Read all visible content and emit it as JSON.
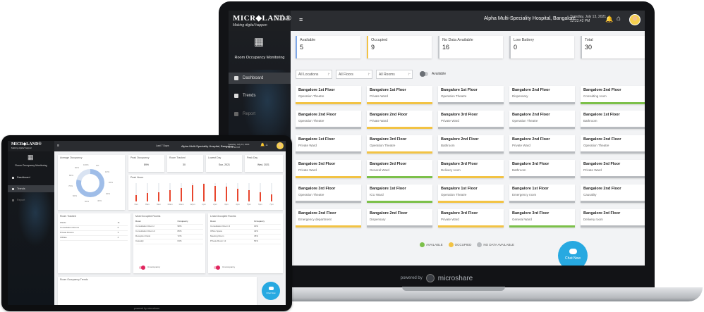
{
  "laptop": {
    "brand": {
      "logo": "MICR◆LAND®",
      "tagline": "Making digital happen",
      "established": "Ahead since 1989"
    },
    "header": {
      "hospital": "Alpha Multi-Speciality Hospital, Bangalore",
      "date": "Tuesday, July 13, 2021",
      "time": "12:22:42 PM"
    },
    "sidebar": {
      "app_name": "Room Occupancy Monitoring",
      "items": [
        {
          "label": "Dashboard"
        },
        {
          "label": "Trends"
        },
        {
          "label": "Report"
        }
      ]
    },
    "stats": [
      {
        "label": "Available",
        "value": "5",
        "color": "#7fa8e8"
      },
      {
        "label": "Occupied",
        "value": "9",
        "color": "#f2c344"
      },
      {
        "label": "No Data Available",
        "value": "16",
        "color": "#c3c6ca"
      },
      {
        "label": "Low Battery",
        "value": "0",
        "color": "#c3c6ca"
      },
      {
        "label": "Total",
        "value": "30",
        "color": "#c3c6ca"
      }
    ],
    "filters": {
      "location": "All Locations",
      "floor": "All Floors",
      "room": "All Rooms",
      "toggle_label": "Available"
    },
    "rooms": [
      [
        {
          "floor": "Bangalore 1st Floor",
          "room": "Operation Theatre",
          "status": "occupied"
        },
        {
          "floor": "Bangalore 1st Floor",
          "room": "Private Ward",
          "status": "occupied"
        },
        {
          "floor": "Bangalore 1st Floor",
          "room": "Operation Theatre",
          "status": "nodata"
        },
        {
          "floor": "Bangalore 2nd Floor",
          "room": "Dispensary",
          "status": "nodata"
        },
        {
          "floor": "Bangalore 2nd Floor",
          "room": "Consulting room",
          "status": "available"
        }
      ],
      [
        {
          "floor": "Bangalore 2nd Floor",
          "room": "Operation Theatre",
          "status": "nodata"
        },
        {
          "floor": "Bangalore 2nd Floor",
          "room": "Private Ward",
          "status": "occupied"
        },
        {
          "floor": "Bangalore 3rd Floor",
          "room": "Private Ward",
          "status": "nodata"
        },
        {
          "floor": "Bangalore 2nd Floor",
          "room": "Operation Theatre",
          "status": "nodata"
        },
        {
          "floor": "Bangalore 1st Floor",
          "room": "Bathroom",
          "status": "nodata"
        }
      ],
      [
        {
          "floor": "Bangalore 1st Floor",
          "room": "Private Ward",
          "status": "nodata"
        },
        {
          "floor": "Bangalore 3rd Floor",
          "room": "Operation Theatre",
          "status": "occupied"
        },
        {
          "floor": "Bangalore 2nd Floor",
          "room": "Bathroom",
          "status": "nodata"
        },
        {
          "floor": "Bangalore 2nd Floor",
          "room": "Private Ward",
          "status": "nodata"
        },
        {
          "floor": "Bangalore 2nd Floor",
          "room": "Operation Theatre",
          "status": "nodata"
        }
      ],
      [
        {
          "floor": "Bangalore 3rd Floor",
          "room": "Private Ward",
          "status": "occupied"
        },
        {
          "floor": "Bangalore 3rd Floor",
          "room": "General Ward",
          "status": "available"
        },
        {
          "floor": "Bangalore 3rd Floor",
          "room": "Delivery room",
          "status": "occupied"
        },
        {
          "floor": "Bangalore 3rd Floor",
          "room": "Bathroom",
          "status": "nodata"
        },
        {
          "floor": "Bangalore 3rd Floor",
          "room": "Private Ward",
          "status": "nodata"
        }
      ],
      [
        {
          "floor": "Bangalore 3rd Floor",
          "room": "Operation Theatre",
          "status": "nodata"
        },
        {
          "floor": "Bangalore 1st Floor",
          "room": "ICU Ward",
          "status": "available"
        },
        {
          "floor": "Bangalore 1st Floor",
          "room": "Operation Theatre",
          "status": "occupied"
        },
        {
          "floor": "Bangalore 1st Floor",
          "room": "Emergency room",
          "status": "nodata"
        },
        {
          "floor": "Bangalore 2nd Floor",
          "room": "Causality",
          "status": "nodata"
        }
      ],
      [
        {
          "floor": "Bangalore 2nd Floor",
          "room": "Emergency department",
          "status": "occupied"
        },
        {
          "floor": "Bangalore 2nd Floor",
          "room": "Dispensary",
          "status": "nodata"
        },
        {
          "floor": "Bangalore 3rd Floor",
          "room": "Private Ward",
          "status": "occupied"
        },
        {
          "floor": "Bangalore 3rd Floor",
          "room": "General Ward",
          "status": "available"
        },
        {
          "floor": "Bangalore 3rd Floor",
          "room": "Delivery room",
          "status": "nodata"
        }
      ]
    ],
    "legend": [
      {
        "label": "AVAILABLE",
        "color": "#7cc04a"
      },
      {
        "label": "OCCUPIED",
        "color": "#f2c344"
      },
      {
        "label": "NO DATA AVAILABLE",
        "color": "#b8bbbf"
      }
    ],
    "chat_label": "Chat Now",
    "footer": {
      "powered": "powered by",
      "brand": "microshare"
    }
  },
  "tablet": {
    "brand": {
      "logo": "MICR◆LAND®",
      "tagline": "Making digital happen"
    },
    "header": {
      "last": "Last 7 Days",
      "hospital": "Alpha Multi-Speciality Hospital, Bangalore",
      "date": "Tuesday, July 13, 2021",
      "time": "12:22:42 PM"
    },
    "sidebar": {
      "app_name": "Room Occupancy Monitoring",
      "items": [
        {
          "label": "Dashboard"
        },
        {
          "label": "Trends"
        },
        {
          "label": "Report"
        }
      ]
    },
    "avg_title": "Average Occupancy",
    "donut_value": 79,
    "donut_labels": [
      "0%",
      "10%",
      "20%",
      "30%",
      "40%",
      "50%",
      "60%",
      "70%",
      "80%",
      "90%",
      "100%"
    ],
    "peak": [
      {
        "title": "Peak Occupancy",
        "value": "89%"
      },
      {
        "title": "Room Tracked",
        "value": "30"
      },
      {
        "title": "Lowest Day",
        "value": "Sun, 2021"
      },
      {
        "title": "Peak Day",
        "value": "Wed, 2021"
      }
    ],
    "peak_hours": {
      "title": "Peak Hours",
      "labels": [
        "7am",
        "8am",
        "9am",
        "10am",
        "11am",
        "12pm",
        "1pm",
        "2pm",
        "3pm",
        "4pm",
        "5pm",
        "6pm",
        "7pm"
      ],
      "values": [
        0.35,
        0.45,
        0.5,
        0.6,
        0.75,
        0.9,
        0.95,
        0.85,
        0.8,
        0.7,
        0.6,
        0.5,
        0.4
      ]
    },
    "rooms_tracked": {
      "title": "Room Tracked",
      "rows": [
        {
          "name": "Wards",
          "value": "11"
        },
        {
          "name": "Consultation Rooms",
          "value": "6"
        },
        {
          "name": "Private Rooms",
          "value": "3"
        },
        {
          "name": "Utilities",
          "value": "4"
        }
      ]
    },
    "most_occupied": {
      "title": "Most Occupied Rooms",
      "head": [
        "Room",
        "Occupancy"
      ],
      "rows": [
        {
          "name": "Consultation Room I",
          "value": "98%"
        },
        {
          "name": "Consultation Room 2",
          "value": "89%"
        },
        {
          "name": "Reception Desk",
          "value": "72%"
        },
        {
          "name": "Casualty",
          "value": "64%"
        }
      ],
      "toggle": "Unoccupancy"
    },
    "least_occupied": {
      "title": "Least Occupied Rooms",
      "head": [
        "Room",
        "Occupancy"
      ],
      "rows": [
        {
          "name": "Consultation Room 3",
          "value": "30%"
        },
        {
          "name": "Office Space",
          "value": "42%"
        },
        {
          "name": "Meeting Room",
          "value": "45%"
        },
        {
          "name": "Private Room 12",
          "value": "54%"
        }
      ],
      "toggle": "Unoccupancy"
    },
    "trends_title": "Room Occupancy Trends",
    "chat_label": "Chat Now",
    "footer": "powered by microshare"
  }
}
